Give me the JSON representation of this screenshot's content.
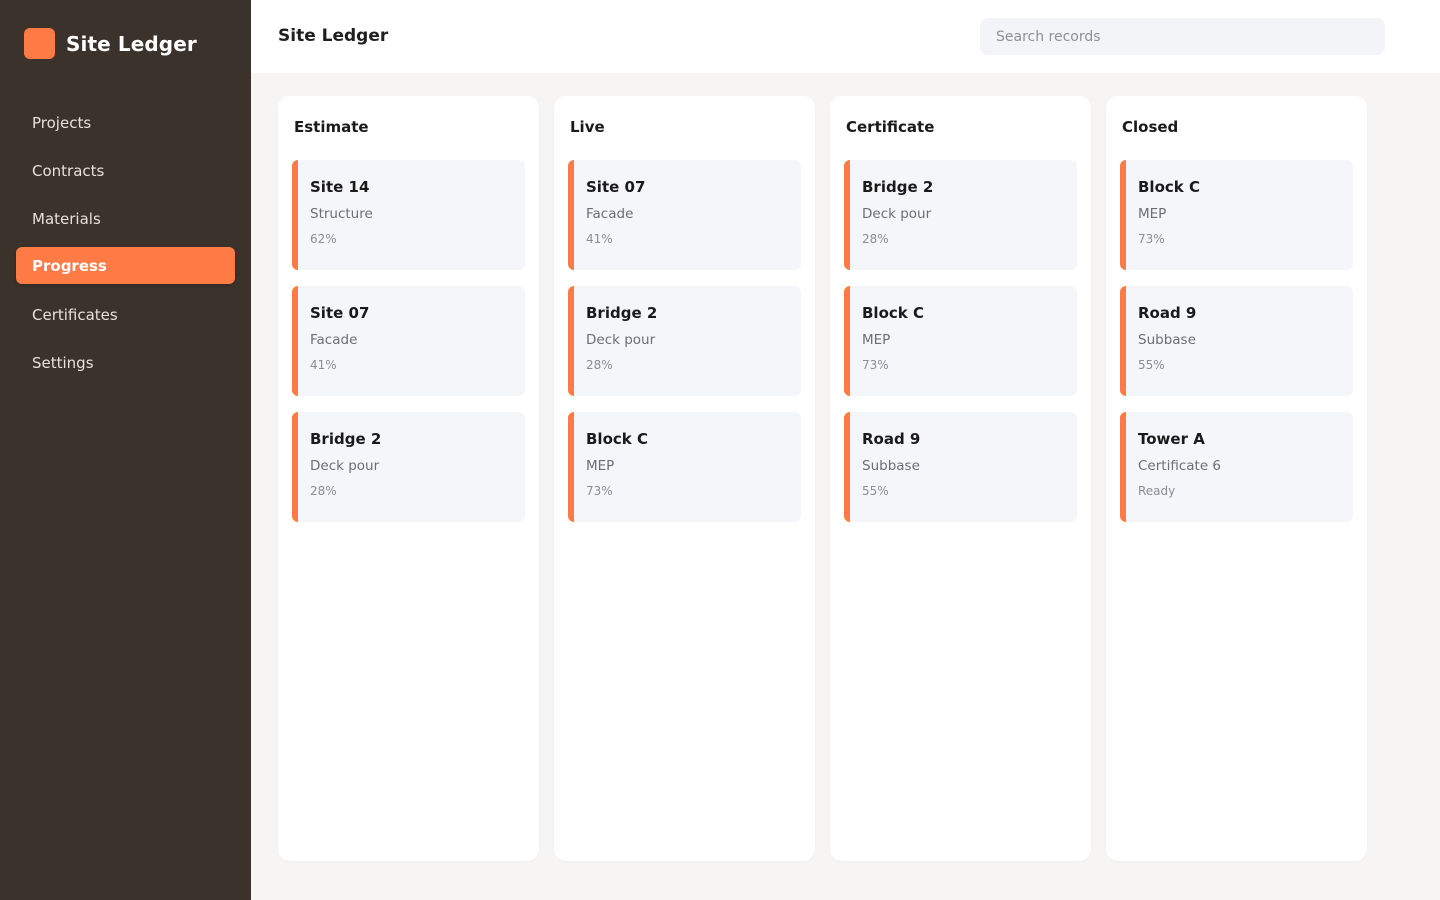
{
  "app": {
    "name": "Site Ledger",
    "accent": "#ff7b45",
    "sidebar_bg": "#3b322b"
  },
  "sidebar": {
    "items": [
      {
        "label": "Projects",
        "active": false
      },
      {
        "label": "Contracts",
        "active": false
      },
      {
        "label": "Materials",
        "active": false
      },
      {
        "label": "Progress",
        "active": true
      },
      {
        "label": "Certificates",
        "active": false
      },
      {
        "label": "Settings",
        "active": false
      }
    ]
  },
  "header": {
    "title": "Site Ledger",
    "search_placeholder": "Search records"
  },
  "board": {
    "columns": [
      {
        "title": "Estimate",
        "cards": [
          {
            "title": "Site 14",
            "subtitle": "Structure",
            "meta": "62%"
          },
          {
            "title": "Site 07",
            "subtitle": "Facade",
            "meta": "41%"
          },
          {
            "title": "Bridge 2",
            "subtitle": "Deck pour",
            "meta": "28%"
          }
        ]
      },
      {
        "title": "Live",
        "cards": [
          {
            "title": "Site 07",
            "subtitle": "Facade",
            "meta": "41%"
          },
          {
            "title": "Bridge 2",
            "subtitle": "Deck pour",
            "meta": "28%"
          },
          {
            "title": "Block C",
            "subtitle": "MEP",
            "meta": "73%"
          }
        ]
      },
      {
        "title": "Certificate",
        "cards": [
          {
            "title": "Bridge 2",
            "subtitle": "Deck pour",
            "meta": "28%"
          },
          {
            "title": "Block C",
            "subtitle": "MEP",
            "meta": "73%"
          },
          {
            "title": "Road 9",
            "subtitle": "Subbase",
            "meta": "55%"
          }
        ]
      },
      {
        "title": "Closed",
        "cards": [
          {
            "title": "Block C",
            "subtitle": "MEP",
            "meta": "73%"
          },
          {
            "title": "Road 9",
            "subtitle": "Subbase",
            "meta": "55%"
          },
          {
            "title": "Tower A",
            "subtitle": "Certificate 6",
            "meta": "Ready"
          }
        ]
      }
    ]
  }
}
